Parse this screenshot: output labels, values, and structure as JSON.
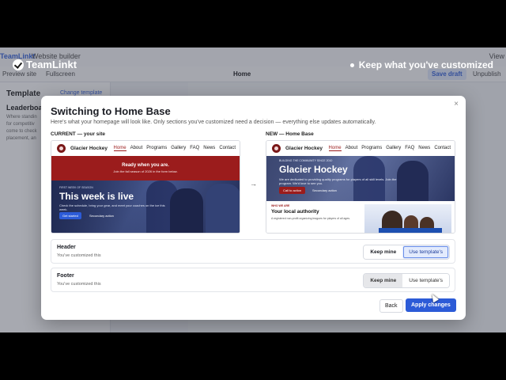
{
  "watermark": {
    "brand": "TeamLinkt",
    "caption": "Keep what you've customized"
  },
  "topbar": {
    "brand": "TeamLinkt",
    "crumb": "Website builder",
    "view": "View"
  },
  "toolbar": {
    "preview": "Preview site",
    "fullscreen": "Fullscreen",
    "page": "Home",
    "save": "Save draft",
    "unpublish": "Unpublish"
  },
  "leftpanel": {
    "heading": "Template",
    "change": "Change template",
    "section": "Leaderboa",
    "desc": "Where standin for competitiv come to check placement, an"
  },
  "modal": {
    "title": "Switching to Home Base",
    "subtitle": "Here's what your homepage will look like. Only sections you've customized need a decision — everything else updates automatically.",
    "current_label": "CURRENT — your site",
    "new_label": "NEW — Home Base",
    "arrow": "→",
    "close": "×"
  },
  "current_preview": {
    "site_name": "Glacier Hockey",
    "nav": [
      "Home",
      "About",
      "Programs",
      "Gallery",
      "FAQ",
      "News",
      "Contact"
    ],
    "banner_title": "Ready when you are.",
    "banner_text": "Join the fall season of 2026 in the form below.",
    "hero_kicker": "FIRST WEEK OF SEASON",
    "hero_title": "This week is live",
    "hero_text": "Check the schedule, bring your gear, and meet your coaches on the ice this week.",
    "primary_cta": "Get started",
    "secondary_cta": "Secondary action"
  },
  "new_preview": {
    "site_name": "Glacier Hockey",
    "nav": [
      "Home",
      "About",
      "Programs",
      "Gallery",
      "FAQ",
      "News",
      "Contact"
    ],
    "hero_kicker": "BUILDING THE COMMUNITY SINCE 2010",
    "hero_title": "Glacier Hockey",
    "hero_text": "We are dedicated to providing quality programs for players of all skill levels. Join the program. We'd love to see you.",
    "primary_cta": "Call to action",
    "secondary_cta": "Secondary action",
    "about_tag": "WHO WE ARE",
    "about_title": "Your local authority",
    "about_text": "A registered non-profit organizing leagues for players of all ages."
  },
  "sections": [
    {
      "title": "Header",
      "status": "You've customized this",
      "keep": "Keep mine",
      "use": "Use template's",
      "selected": "use"
    },
    {
      "title": "Footer",
      "status": "You've customized this",
      "keep": "Keep mine",
      "use": "Use template's",
      "selected": "keep"
    }
  ],
  "actions": {
    "back": "Back",
    "apply": "Apply changes"
  },
  "colors": {
    "accent": "#2c5bd7",
    "brand_red": "#9b1c1c"
  }
}
